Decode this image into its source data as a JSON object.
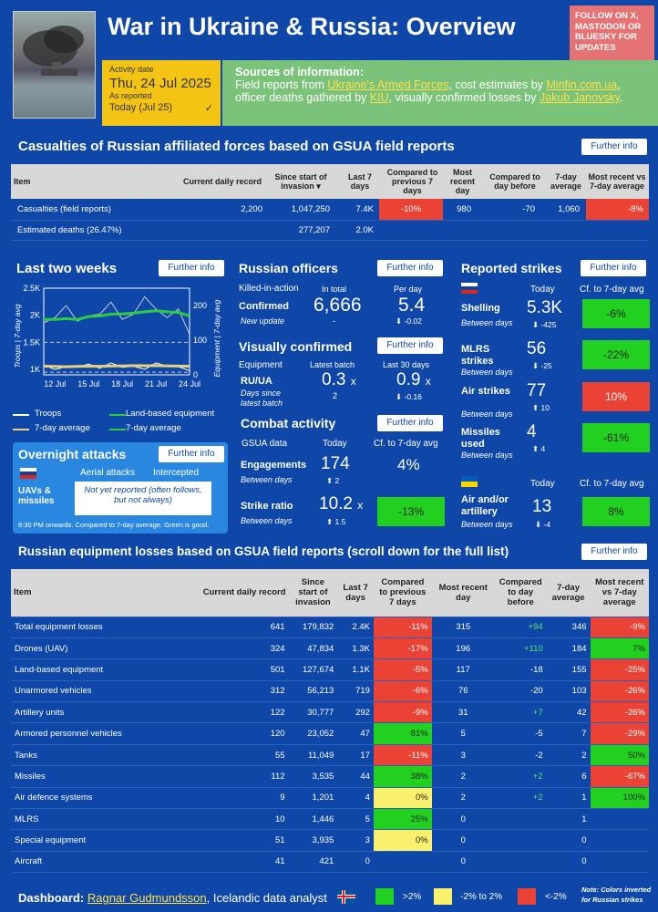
{
  "header": {
    "title": "War in Ukraine & Russia: Overview",
    "follow": "FOLLOW ON X, MASTODON OR BLUESKY FOR UPDATES",
    "activity_label": "Activity date",
    "activity_date": "Thu, 24 Jul 2025",
    "as_reported": "As reported",
    "today": "Today (Jul 25)",
    "check": "✓",
    "sources_title": "Sources of information:",
    "sources_t1": "Field reports from ",
    "sources_l1": "Ukraine's Armed Forces",
    "sources_t2": ", cost estimates by ",
    "sources_l2": "Minfin.com.ua",
    "sources_t3": ", officer deaths gathered by ",
    "sources_l3": "KIU",
    "sources_t4": ", visually confirmed losses by ",
    "sources_l4": "Jakub Janovsky",
    "sources_t5": "."
  },
  "further": "Further info",
  "casualties": {
    "title": "Casualties of Russian affiliated forces based on GSUA field reports",
    "headers": [
      "Item",
      "Current daily record",
      "Since start of invasion",
      "Last 7 days",
      "Compared to previous 7 days",
      "Most recent day",
      "Compared to day before",
      "7-day average",
      "Most recent vs 7-day average"
    ],
    "sort_icon": "▾",
    "rows": [
      {
        "item": "Casualties (field reports)",
        "record": "2,200",
        "since": "1,047,250",
        "last7": "7.4K",
        "cmp7": "-10%",
        "recent": "980",
        "cmpday": "-70",
        "avg": "1,060",
        "vsavg": "-8%"
      },
      {
        "item": "Estimated deaths (26.47%)",
        "record": "",
        "since": "277,207",
        "last7": "2.0K",
        "cmp7": "",
        "recent": "",
        "cmpday": "",
        "avg": "",
        "vsavg": ""
      }
    ]
  },
  "two_weeks": {
    "title": "Last two weeks",
    "y_left_label": "Troops | 7-day avg",
    "y_right_label": "Equipment | 7-day avg",
    "legend": [
      "Troops",
      "Land-based equipment",
      "7-day average",
      "7-day average"
    ]
  },
  "chart_data": {
    "type": "line",
    "x": [
      "11 Jul",
      "12 Jul",
      "13 Jul",
      "14 Jul",
      "15 Jul",
      "16 Jul",
      "17 Jul",
      "18 Jul",
      "19 Jul",
      "20 Jul",
      "21 Jul",
      "22 Jul",
      "23 Jul",
      "24 Jul"
    ],
    "x_ticks": [
      "12 Jul",
      "15 Jul",
      "18 Jul",
      "21 Jul",
      "24 Jul"
    ],
    "y_left_ticks": [
      "2.5K",
      "2K",
      "1.5K",
      "1K"
    ],
    "y_right_ticks": [
      "200",
      "100",
      "0"
    ],
    "ylim_left": [
      900,
      2500
    ],
    "ylim_right": [
      0,
      250
    ],
    "series": [
      {
        "name": "Troops",
        "axis": "left",
        "color": "#ffffff",
        "values": [
          1080,
          1000,
          1050,
          1040,
          1100,
          1020,
          1120,
          1040,
          1060,
          1000,
          1120,
          1060,
          1050,
          980
        ]
      },
      {
        "name": "7-day average",
        "axis": "left",
        "color": "#e8cf7a",
        "values": [
          1060,
          1055,
          1050,
          1055,
          1060,
          1058,
          1062,
          1065,
          1070,
          1068,
          1070,
          1065,
          1062,
          1060
        ]
      },
      {
        "name": "Land-based equipment",
        "axis": "right",
        "color": "#c8ccd8",
        "values": [
          150,
          165,
          200,
          155,
          170,
          175,
          210,
          160,
          175,
          225,
          190,
          165,
          190,
          117
        ]
      },
      {
        "name": "7-day average",
        "axis": "right",
        "color": "#2ecc40",
        "values": [
          160,
          160,
          162,
          160,
          168,
          170,
          175,
          176,
          178,
          182,
          185,
          182,
          180,
          170
        ]
      }
    ],
    "refline_left": 1500,
    "refline_right": 155
  },
  "overnight": {
    "title": "Overnight attacks",
    "col1": "Aerial attacks",
    "col2": "Intercepted",
    "row_label": "UAVs & missiles",
    "not_reported": "Not yet reported (often follows, but not always)",
    "note": "8:30 PM onwards. Compared to 7-day average. Green is good."
  },
  "officers": {
    "title": "Russian officers",
    "kia": "Killed-in-action",
    "in_total": "In total",
    "per_day": "Per day",
    "confirmed": "Confirmed",
    "total": "6,666",
    "per_day_val": "5.4",
    "new_update": "New update",
    "dash": "-",
    "per_day_change": "⬇ -0.02"
  },
  "visual": {
    "title": "Visually confirmed",
    "equipment": "Equipment",
    "latest": "Latest batch",
    "last30": "Last 30 days",
    "ruua": "RU/UA",
    "days_since": "Days since latest batch",
    "latest_val": "0.3",
    "last30_val": "0.9",
    "x": "x",
    "latest_sub": "2",
    "last30_change": "⬇ -0.16"
  },
  "combat": {
    "title": "Combat activity",
    "gsua": "GSUA data",
    "today": "Today",
    "cf": "Cf. to 7-day avg",
    "eng_label": "Engagements",
    "eng_val": "174",
    "eng_pct": "4%",
    "between": "Between days",
    "eng_change": "⬆ 2",
    "strike_label": "Strike ratio",
    "strike_val": "10.2",
    "strike_x": "x",
    "strike_pct": "-13%",
    "strike_change": "⬆ 1.5"
  },
  "strikes": {
    "title": "Reported strikes",
    "today": "Today",
    "cf": "Cf. to 7-day avg",
    "between": "Between days",
    "rows": [
      {
        "label": "Shelling",
        "val": "5.3K",
        "change": "⬇ -425",
        "pct": "-6%",
        "color": "green"
      },
      {
        "label": "MLRS strikes",
        "val": "56",
        "change": "⬇ -25",
        "pct": "-22%",
        "color": "green"
      },
      {
        "label": "Air strikes",
        "val": "77",
        "change": "⬆ 10",
        "pct": "10%",
        "color": "red"
      },
      {
        "label": "Missiles used",
        "val": "4",
        "change": "⬆ 4",
        "pct": "-61%",
        "color": "green"
      }
    ],
    "ua_today": "Today",
    "ua_cf": "Cf. to 7-day avg",
    "ua_label": "Air and/or artillery",
    "ua_val": "13",
    "ua_change": "⬇ -4",
    "ua_pct": "8%"
  },
  "equipment": {
    "title": "Russian equipment losses based on GSUA field reports (scroll down for the full list)",
    "headers": [
      "Item",
      "Current daily record",
      "Since start of invasion",
      "Last 7 days",
      "Compared to previous 7 days",
      "Most recent day",
      "Compared to day before",
      "7-day average",
      "Most recent vs 7-day average"
    ],
    "rows": [
      {
        "item": "Total equipment losses",
        "record": "641",
        "since": "179,832",
        "last7": "2.4K",
        "cmp7": "-11%",
        "c7": "red",
        "recent": "315",
        "cmpday": "+94",
        "avg": "346",
        "vs": "-9%",
        "cv": "red"
      },
      {
        "item": "Drones (UAV)",
        "record": "324",
        "since": "47,834",
        "last7": "1.3K",
        "cmp7": "-17%",
        "c7": "red",
        "recent": "196",
        "cmpday": "+110",
        "avg": "184",
        "vs": "7%",
        "cv": "green"
      },
      {
        "item": "Land-based equipment",
        "record": "501",
        "since": "127,674",
        "last7": "1.1K",
        "cmp7": "-5%",
        "c7": "red",
        "recent": "117",
        "cmpday": "-18",
        "avg": "155",
        "vs": "-25%",
        "cv": "red"
      },
      {
        "item": "Unarmored vehicles",
        "record": "312",
        "since": "56,213",
        "last7": "719",
        "cmp7": "-6%",
        "c7": "red",
        "recent": "76",
        "cmpday": "-20",
        "avg": "103",
        "vs": "-26%",
        "cv": "red"
      },
      {
        "item": "Artillery units",
        "record": "122",
        "since": "30,777",
        "last7": "292",
        "cmp7": "-9%",
        "c7": "red",
        "recent": "31",
        "cmpday": "+7",
        "avg": "42",
        "vs": "-26%",
        "cv": "red"
      },
      {
        "item": "Armored personnel vehicles",
        "record": "120",
        "since": "23,052",
        "last7": "47",
        "cmp7": "81%",
        "c7": "green",
        "recent": "5",
        "cmpday": "-5",
        "avg": "7",
        "vs": "-29%",
        "cv": "red"
      },
      {
        "item": "Tanks",
        "record": "55",
        "since": "11,049",
        "last7": "17",
        "cmp7": "-11%",
        "c7": "red",
        "recent": "3",
        "cmpday": "-2",
        "avg": "2",
        "vs": "50%",
        "cv": "green"
      },
      {
        "item": "Missiles",
        "record": "112",
        "since": "3,535",
        "last7": "44",
        "cmp7": "38%",
        "c7": "green",
        "recent": "2",
        "cmpday": "+2",
        "avg": "6",
        "vs": "-67%",
        "cv": "red"
      },
      {
        "item": "Air defence systems",
        "record": "9",
        "since": "1,201",
        "last7": "4",
        "cmp7": "0%",
        "c7": "yellow",
        "recent": "2",
        "cmpday": "+2",
        "avg": "1",
        "vs": "100%",
        "cv": "green"
      },
      {
        "item": "MLRS",
        "record": "10",
        "since": "1,446",
        "last7": "5",
        "cmp7": "25%",
        "c7": "green",
        "recent": "0",
        "cmpday": "",
        "avg": "1",
        "vs": "",
        "cv": ""
      },
      {
        "item": "Special equipment",
        "record": "51",
        "since": "3,935",
        "last7": "3",
        "cmp7": "0%",
        "c7": "yellow",
        "recent": "0",
        "cmpday": "",
        "avg": "0",
        "vs": "",
        "cv": ""
      },
      {
        "item": "Aircraft",
        "record": "41",
        "since": "421",
        "last7": "0",
        "cmp7": "",
        "c7": "",
        "recent": "0",
        "cmpday": "",
        "avg": "0",
        "vs": "",
        "cv": ""
      }
    ]
  },
  "footer": {
    "label": "Dashboard: ",
    "author": "Ragnar Gudmundsson",
    "role": ", Icelandic data analyst",
    "leg1": ">2%",
    "leg2": "-2% to 2%",
    "leg3": "<-2%",
    "note": "Note: Colors inverted for Russian strikes"
  },
  "colors": {
    "bg": "#0e47a8",
    "red": "#ea4335",
    "green": "#22d11f",
    "yellow": "#f9f06d",
    "header_yellow": "#f4c414",
    "sources_green": "#7bc27a",
    "follow": "#e57373"
  }
}
